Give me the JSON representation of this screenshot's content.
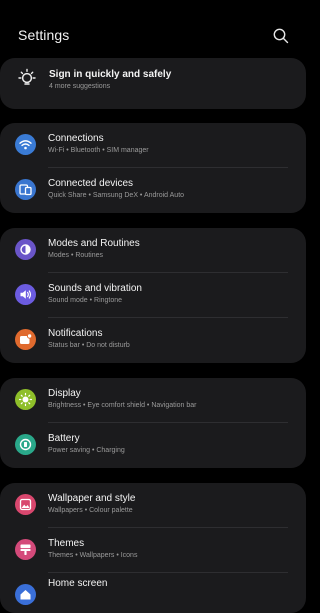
{
  "header": {
    "title": "Settings",
    "search_icon": "search-icon"
  },
  "suggestion": {
    "title": "Sign in quickly and safely",
    "subtitle": "4 more suggestions",
    "icon": "lightbulb-icon"
  },
  "groups": [
    {
      "items": [
        {
          "title": "Connections",
          "subtitle": "Wi-Fi  •  Bluetooth  •  SIM manager",
          "icon": "wifi-icon",
          "color": "#3a7bd5"
        },
        {
          "title": "Connected devices",
          "subtitle": "Quick Share  •  Samsung DeX  •  Android Auto",
          "icon": "connected-devices-icon",
          "color": "#3a76d0"
        }
      ]
    },
    {
      "items": [
        {
          "title": "Modes and Routines",
          "subtitle": "Modes  •  Routines",
          "icon": "modes-icon",
          "color": "#6a55c8"
        },
        {
          "title": "Sounds and vibration",
          "subtitle": "Sound mode  •  Ringtone",
          "icon": "volume-icon",
          "color": "#6c5ce0"
        },
        {
          "title": "Notifications",
          "subtitle": "Status bar  •  Do not disturb",
          "icon": "notification-icon",
          "color": "#e06a2e"
        }
      ]
    },
    {
      "items": [
        {
          "title": "Display",
          "subtitle": "Brightness  •  Eye comfort shield  •  Navigation bar",
          "icon": "sun-icon",
          "color": "#8fbf2a"
        },
        {
          "title": "Battery",
          "subtitle": "Power saving  •  Charging",
          "icon": "battery-icon",
          "color": "#2aa88a"
        }
      ]
    },
    {
      "items": [
        {
          "title": "Wallpaper and style",
          "subtitle": "Wallpapers  •  Colour palette",
          "icon": "wallpaper-icon",
          "color": "#d9476e"
        },
        {
          "title": "Themes",
          "subtitle": "Themes  •  Wallpapers  •  Icons",
          "icon": "themes-icon",
          "color": "#d44a7a"
        },
        {
          "title": "Home screen",
          "subtitle": "",
          "icon": "home-icon",
          "color": "#3a6fd8"
        }
      ]
    }
  ]
}
